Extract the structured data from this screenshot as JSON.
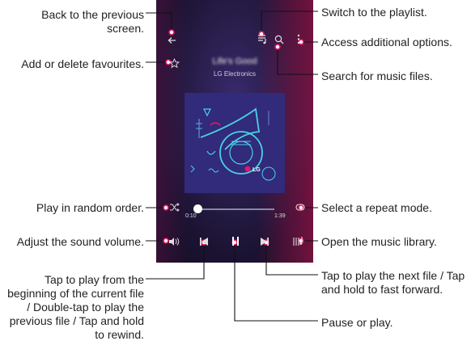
{
  "player": {
    "song_title": "Life's Good",
    "artist": "LG Electronics",
    "current_time": "0:10",
    "total_time": "1:39",
    "progress_fraction": 0.05,
    "album_logo": "LG",
    "icons": {
      "back": "back-arrow-icon",
      "playlist": "playlist-icon",
      "search": "search-icon",
      "more": "more-options-icon",
      "favourite": "star-icon",
      "shuffle": "shuffle-icon",
      "repeat": "repeat-icon",
      "volume": "volume-icon",
      "previous": "previous-icon",
      "play_pause": "pause-icon",
      "next": "next-icon",
      "library": "library-icon"
    }
  },
  "annotations": {
    "back": "Back to the previous screen.",
    "favourite": "Add or delete favourites.",
    "shuffle": "Play in random order.",
    "volume": "Adjust the sound volume.",
    "previous": "Tap to play from the beginning of the current file / Double-tap to play the previous file / Tap and hold to rewind.",
    "playlist": "Switch to the playlist.",
    "more": "Access additional options.",
    "search": "Search for music files.",
    "repeat": "Select a repeat mode.",
    "library": "Open the music library.",
    "next": "Tap to play the next file / Tap and hold to fast forward.",
    "pause": "Pause or play."
  },
  "colors": {
    "callout_dot": "#e0165a",
    "background_top": "#3a2a6e",
    "background_bottom": "#140e24",
    "accent_magenta": "#be1450"
  }
}
